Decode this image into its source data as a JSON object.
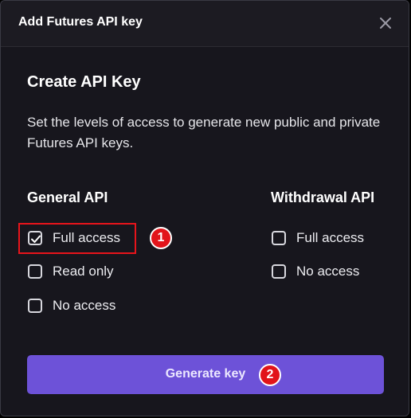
{
  "dialog": {
    "title": "Add Futures API key",
    "close_icon": "close-icon"
  },
  "content": {
    "heading": "Create API Key",
    "description": "Set the levels of access to generate new public and private Futures API keys."
  },
  "general_api": {
    "title": "General API",
    "options": [
      {
        "label": "Full access",
        "checked": true
      },
      {
        "label": "Read only",
        "checked": false
      },
      {
        "label": "No access",
        "checked": false
      }
    ]
  },
  "withdrawal_api": {
    "title": "Withdrawal API",
    "options": [
      {
        "label": "Full access",
        "checked": false
      },
      {
        "label": "No access",
        "checked": false
      }
    ]
  },
  "generate_button": {
    "label": "Generate key"
  },
  "annotations": {
    "step1": "1",
    "step2": "2",
    "highlight_color": "#e8141b"
  },
  "colors": {
    "dialog_bg": "#17161d",
    "header_bg": "#1c1b22",
    "button_bg": "#6d52d8",
    "text": "#ffffff"
  }
}
